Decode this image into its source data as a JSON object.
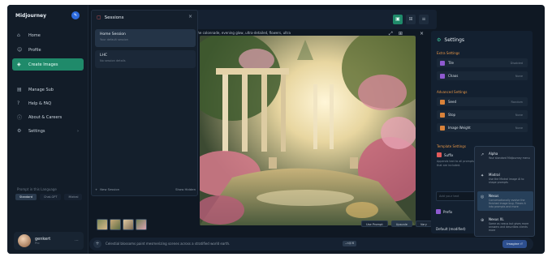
{
  "sidebar": {
    "brand": "Midjourney",
    "brand_action": "✎",
    "items": [
      {
        "label": "Home",
        "icon": "home-icon",
        "glyph": "⌂"
      },
      {
        "label": "Profile",
        "icon": "profile-icon",
        "glyph": "☺"
      },
      {
        "label": "Create Images",
        "icon": "create-icon",
        "glyph": "◈"
      },
      {
        "label": "Manage Sub",
        "icon": "subscription-icon",
        "glyph": "▤"
      },
      {
        "label": "Help & FAQ",
        "icon": "help-icon",
        "glyph": "?"
      },
      {
        "label": "About & Careers",
        "icon": "info-icon",
        "glyph": "ⓘ"
      },
      {
        "label": "Settings",
        "icon": "settings-icon",
        "glyph": "⚙",
        "chevron": "›"
      }
    ],
    "language_label": "Prompt in this Language",
    "languages": [
      "Standard",
      "Chat-GPT",
      "Mixtral"
    ],
    "user": {
      "name": "genkert",
      "sub": "Pro",
      "more": "⋯"
    }
  },
  "sessions": {
    "title": "Sessions",
    "close": "×",
    "items": [
      {
        "title": "Home Session",
        "subtitle": "Your default session"
      },
      {
        "title": "LHC",
        "subtitle": "No session details"
      }
    ],
    "new_session": "New Session",
    "show_hidden": "Show Hidden"
  },
  "toolbar": {
    "buttons": [
      "▣",
      "⊞",
      "≡"
    ]
  },
  "image": {
    "prompt_overlay": "...the colonnade, evening glow, ultra-detailed, flowers, ultra-realistic, glowing sunlight in the background, misty alt...",
    "tools": [
      "⤢",
      "⊞"
    ],
    "close": "×",
    "actions": [
      "Use Prompt",
      "Upscale",
      "Vary"
    ]
  },
  "prompt": {
    "plus": "+",
    "placeholder": "Celestial blossoms paint mesmerizing scenes across a stratified world earth.",
    "tag": "--niji 6",
    "send": "Imagine ⏎"
  },
  "settings": {
    "title": "Settings",
    "extra_title": "Extra Settings",
    "extra": [
      {
        "label": "Tile",
        "value": "Disabled"
      },
      {
        "label": "Chaos",
        "value": "None"
      }
    ],
    "advanced_title": "Advanced Settings",
    "advanced": [
      {
        "label": "Seed",
        "value": "Random"
      },
      {
        "label": "Stop",
        "value": "None"
      },
      {
        "label": "Image Weight",
        "value": "None"
      }
    ],
    "template_title": "Template Settings",
    "suffix_label": "Suffix",
    "suffix_desc": "Appends text to all prompts that are included.",
    "suffix_placeholder": "Add your text",
    "prefix_label": "Prefix",
    "default_label": "Default (modified)"
  },
  "model_menu": [
    {
      "title": "Alpha",
      "desc": "Your standard Midjourney menu",
      "glyph": "↗"
    },
    {
      "title": "Mixtral",
      "desc": "Use the Mixtral image AI to shape prompts",
      "glyph": "✦"
    },
    {
      "title": "Nexus",
      "desc": "Conversationally evolve the finished image bug. Flexes it into prompts and more",
      "glyph": "◎"
    },
    {
      "title": "Nexus XL",
      "desc": "Same as nexus but gives more answers and describes clients more",
      "glyph": "⊕"
    }
  ],
  "colors": {
    "accent": "#1f8a6a",
    "section_title": "#e69546",
    "app_bg": "#0f1823"
  }
}
